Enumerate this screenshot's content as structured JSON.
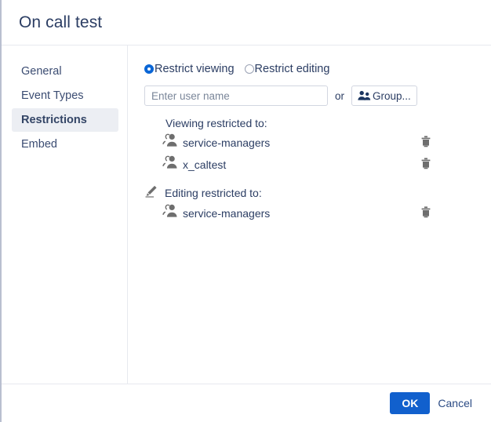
{
  "dialog": {
    "title": "On call test"
  },
  "sidebar": {
    "items": [
      {
        "label": "General",
        "active": false
      },
      {
        "label": "Event Types",
        "active": false
      },
      {
        "label": "Restrictions",
        "active": true
      },
      {
        "label": "Embed",
        "active": false
      }
    ]
  },
  "restrictions": {
    "radios": [
      {
        "label": "Restrict viewing",
        "selected": true
      },
      {
        "label": "Restrict editing",
        "selected": false
      }
    ],
    "user_input": {
      "value": "",
      "placeholder": "Enter user name"
    },
    "or_label": "or",
    "group_button": {
      "label": "Group...",
      "icon": "group-icon"
    },
    "viewing": {
      "heading": "Viewing restricted to:",
      "entries": [
        {
          "name": "service-managers",
          "icon": "group-icon",
          "delete_icon": "trash-icon"
        },
        {
          "name": "x_caltest",
          "icon": "group-icon",
          "delete_icon": "trash-icon"
        }
      ]
    },
    "editing": {
      "heading": "Editing restricted to:",
      "heading_icon": "pencil-icon",
      "entries": [
        {
          "name": "service-managers",
          "icon": "group-icon",
          "delete_icon": "trash-icon"
        }
      ]
    }
  },
  "footer": {
    "ok_label": "OK",
    "cancel_label": "Cancel"
  },
  "colors": {
    "accent": "#1160cd",
    "radio_selected": "#0a66d6",
    "text": "#2b3d63",
    "icon_gray": "#6e6e6e",
    "active_nav_bg": "#eceef3"
  }
}
